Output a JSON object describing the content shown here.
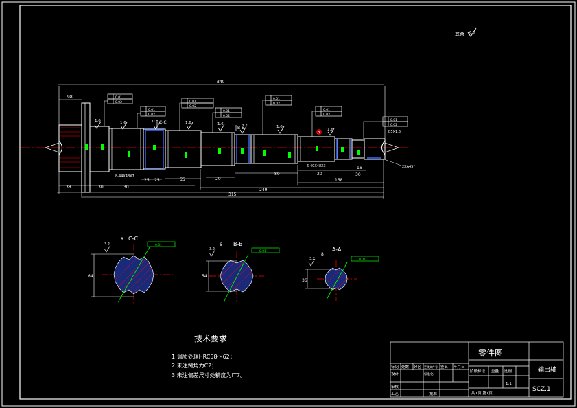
{
  "overall_dims": {
    "d340": "340",
    "d315": "315",
    "d249": "249",
    "d158": "158"
  },
  "segment_dims": [
    "98",
    "30",
    "55",
    "20",
    "80",
    "25",
    "16",
    "30",
    "20",
    "30"
  ],
  "step_dims": [
    "38",
    "25"
  ],
  "shaft_labels": {
    "keyway_main": "8-44X48X7",
    "keyway_right": "6-40X48X3",
    "chamfer": "2XA45°",
    "center_hole": "B5X1.6"
  },
  "roughness": {
    "r16": "1.6",
    "r32": "3.2",
    "r08": "0.8",
    "r63": "6.3",
    "corner": "其余"
  },
  "sections": [
    {
      "title": "C-C",
      "size": "64",
      "keyway": "8"
    },
    {
      "title": "B-B",
      "size": "54",
      "keyway": "6"
    },
    {
      "title": "A-A",
      "size": "36",
      "keyway": "8"
    }
  ],
  "datum_marker": "A",
  "tolerance_frames": [
    "0.01",
    "0.02"
  ],
  "tech_requirements": {
    "title": "技术要求",
    "items": [
      "1.调质处理HRC58～62；",
      "2.未注倒角为C2；",
      "3.未注偏差尺寸处精度为IT7。"
    ]
  },
  "title_block": {
    "drawing_type": "零件图",
    "part_name": "输出轴",
    "drawing_no": "SCZ.1",
    "scale_value": "1:1",
    "sheets": "共1页 第1页",
    "head_cols": [
      "标记",
      "处数",
      "分区",
      "更改文件号",
      "签名",
      "年月日"
    ],
    "stage_label": "阶段标记",
    "weight_label": "重量",
    "scale_label": "比例",
    "roles": [
      "设计",
      "审核",
      "工艺"
    ],
    "standardize": "标准化",
    "approve": "批准"
  },
  "colors": {
    "line": "#ffffff",
    "center": "#ff0000",
    "fill": "#1a2a7a",
    "hatch": "#ff0000",
    "dim_alt": "#00ff00",
    "label": "#ffff00"
  }
}
